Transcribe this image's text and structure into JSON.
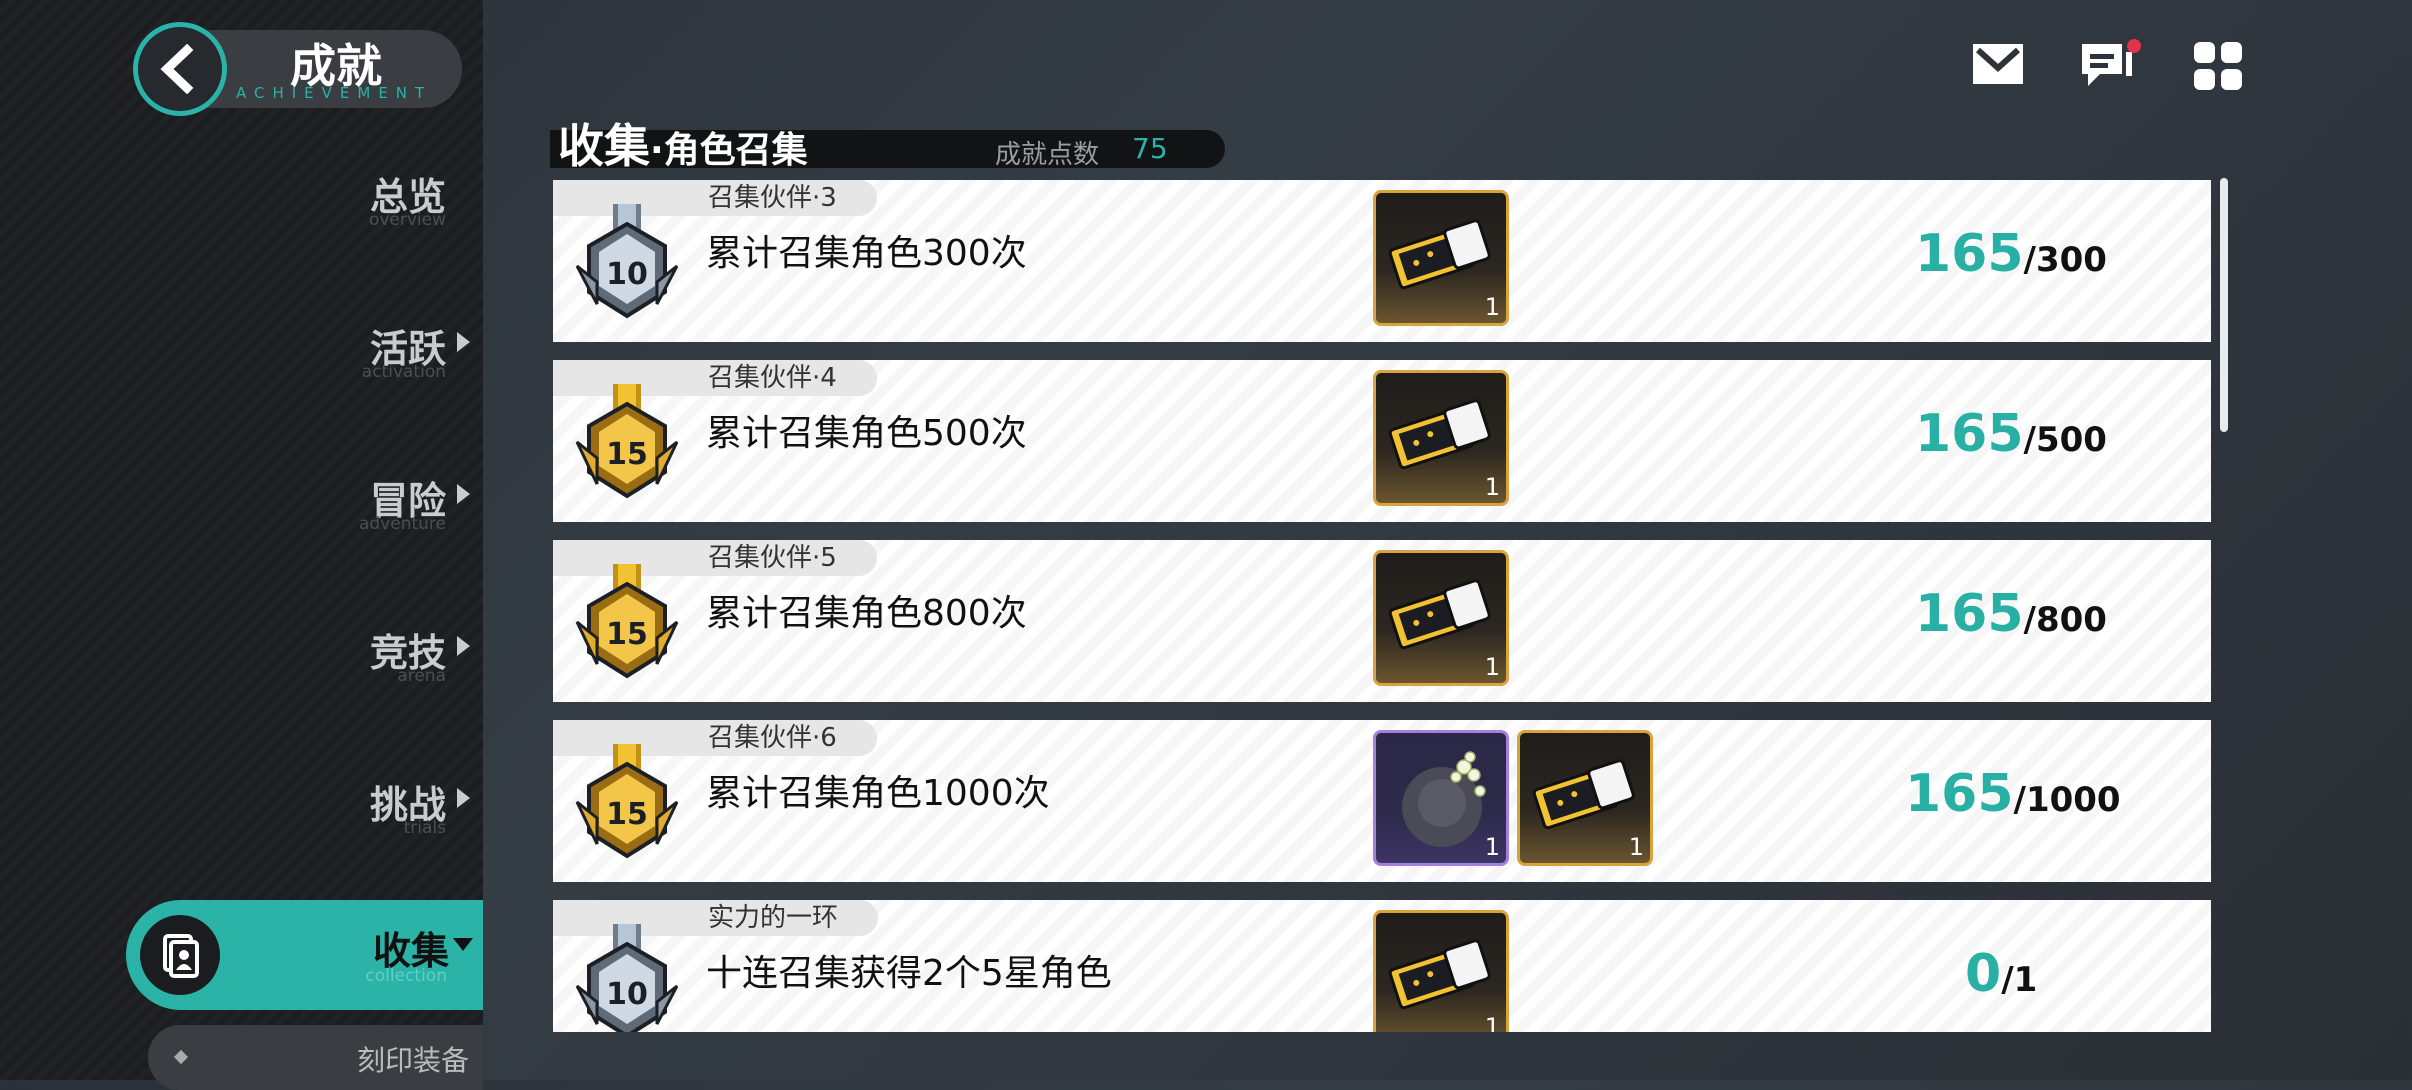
{
  "header": {
    "title": "成就",
    "subtitle": "ACHIEVEMENT"
  },
  "nav": [
    {
      "label": "总览",
      "sub": "overview",
      "arrow": false
    },
    {
      "label": "活跃",
      "sub": "activation",
      "arrow": true
    },
    {
      "label": "冒险",
      "sub": "adventure",
      "arrow": true
    },
    {
      "label": "竞技",
      "sub": "arena",
      "arrow": true
    },
    {
      "label": "挑战",
      "sub": "trials",
      "arrow": true
    }
  ],
  "nav_active": {
    "label": "收集",
    "sub": "collection"
  },
  "subnav": {
    "label": "刻印装备"
  },
  "section": {
    "title": "收集",
    "subtitle": "·角色召集",
    "points_label": "成就点数",
    "points_value": "75"
  },
  "achievements": [
    {
      "tag": "召集伙伴·3",
      "desc": "累计召集角色300次",
      "medal": "10",
      "medal_color": "silver",
      "rewards": [
        {
          "type": "ticket",
          "count": "1"
        }
      ],
      "current": "165",
      "max": "/300"
    },
    {
      "tag": "召集伙伴·4",
      "desc": "累计召集角色500次",
      "medal": "15",
      "medal_color": "gold",
      "rewards": [
        {
          "type": "ticket",
          "count": "1"
        }
      ],
      "current": "165",
      "max": "/500"
    },
    {
      "tag": "召集伙伴·5",
      "desc": "累计召集角色800次",
      "medal": "15",
      "medal_color": "gold",
      "rewards": [
        {
          "type": "ticket",
          "count": "1"
        }
      ],
      "current": "165",
      "max": "/800"
    },
    {
      "tag": "召集伙伴·6",
      "desc": "累计召集角色1000次",
      "medal": "15",
      "medal_color": "gold",
      "rewards": [
        {
          "type": "avatar",
          "count": "1"
        },
        {
          "type": "ticket",
          "count": "1"
        }
      ],
      "current": "165",
      "max": "/1000"
    },
    {
      "tag": "实力的一环",
      "desc": "十连召集获得2个5星角色",
      "medal": "10",
      "medal_color": "silver",
      "rewards": [
        {
          "type": "ticket",
          "count": "1"
        }
      ],
      "current": "0",
      "max": "/1"
    }
  ],
  "icons": [
    "mail-icon",
    "chat-icon",
    "menu-grid-icon"
  ],
  "colors": {
    "accent": "#2ab3a6",
    "gold": "#d7a33a",
    "badge": "#e0344a"
  }
}
